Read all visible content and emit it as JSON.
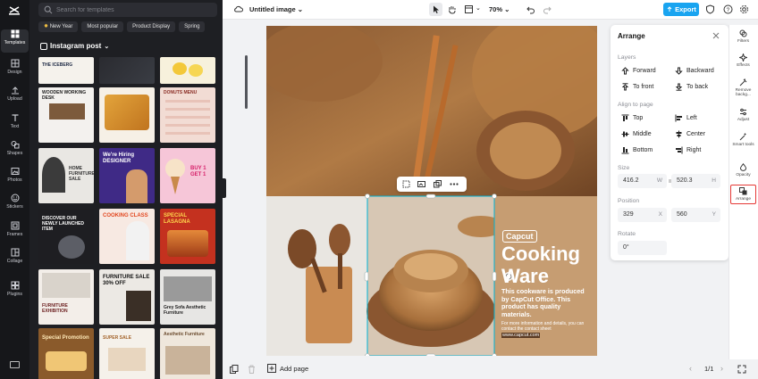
{
  "nav": {
    "items": [
      {
        "label": "Templates",
        "icon": "templates-icon"
      },
      {
        "label": "Design",
        "icon": "design-icon"
      },
      {
        "label": "Upload",
        "icon": "upload-icon"
      },
      {
        "label": "Text",
        "icon": "text-icon"
      },
      {
        "label": "Shapes",
        "icon": "shapes-icon"
      },
      {
        "label": "Photos",
        "icon": "photos-icon"
      },
      {
        "label": "Stickers",
        "icon": "stickers-icon"
      },
      {
        "label": "Frames",
        "icon": "frames-icon"
      },
      {
        "label": "Collage",
        "icon": "collage-icon"
      },
      {
        "label": "Plugins",
        "icon": "plugins-icon"
      }
    ]
  },
  "templates": {
    "search_placeholder": "Search for templates",
    "chips": [
      "New Year",
      "Most popular",
      "Product Display",
      "Spring"
    ],
    "section_title": "Instagram post",
    "thumbs": [
      {
        "caption": "THE ICEBERG"
      },
      {
        "caption": ""
      },
      {
        "caption": ""
      },
      {
        "caption": "WOODEN WORKING DESK"
      },
      {
        "caption": ""
      },
      {
        "caption": "DONUTS MENU"
      },
      {
        "caption": "HOME FURNITURE SALE"
      },
      {
        "caption": "We're Hiring DESIGNER"
      },
      {
        "caption": "BUY 1 GET 1"
      },
      {
        "caption": "DISCOVER OUR NEWLY LAUNCHED ITEM"
      },
      {
        "caption": "COOKING CLASS"
      },
      {
        "caption": "SPECIAL LASAGNA"
      },
      {
        "caption": "FURNITURE EXHIBITION"
      },
      {
        "caption": "FURNITURE SALE 30% OFF"
      },
      {
        "caption": "Grey Sofa Aesthetic Furniture"
      },
      {
        "caption": "Special Promotion"
      },
      {
        "caption": "SUPER SALE"
      },
      {
        "caption": "Aesthetic Furniture"
      }
    ]
  },
  "toolbar": {
    "doc_title": "Untitled image",
    "zoom": "70%",
    "export_label": "Export"
  },
  "canvas": {
    "brand": "Capcut",
    "headline_1": "Cooking",
    "headline_2": "Ware",
    "body": "This cookware is produced by CapCut Office. This product has quality materials.",
    "fine_print": "For more information and details, you can contact the contact sheet",
    "url": "www.capcut.com",
    "accent": "#c69d72"
  },
  "arrange": {
    "title": "Arrange",
    "layers_label": "Layers",
    "forward": "Forward",
    "backward": "Backward",
    "to_front": "To front",
    "to_back": "To back",
    "align_label": "Align to page",
    "top": "Top",
    "left": "Left",
    "middle": "Middle",
    "center": "Center",
    "bottom": "Bottom",
    "right": "Right",
    "size_label": "Size",
    "width": "416.2",
    "width_unit": "W",
    "height": "520.3",
    "height_unit": "H",
    "position_label": "Position",
    "pos_x": "329",
    "pos_x_unit": "X",
    "pos_y": "560",
    "pos_y_unit": "Y",
    "rotate_label": "Rotate",
    "rotate": "0°"
  },
  "tools": {
    "items": [
      {
        "label": "Filters"
      },
      {
        "label": "Effects"
      },
      {
        "label": "Remove backg..."
      },
      {
        "label": "Adjust"
      },
      {
        "label": "Smart tools"
      },
      {
        "label": "Opacity"
      },
      {
        "label": "Arrange"
      }
    ]
  },
  "bottom": {
    "add_page": "Add page",
    "page_count": "1/1"
  }
}
